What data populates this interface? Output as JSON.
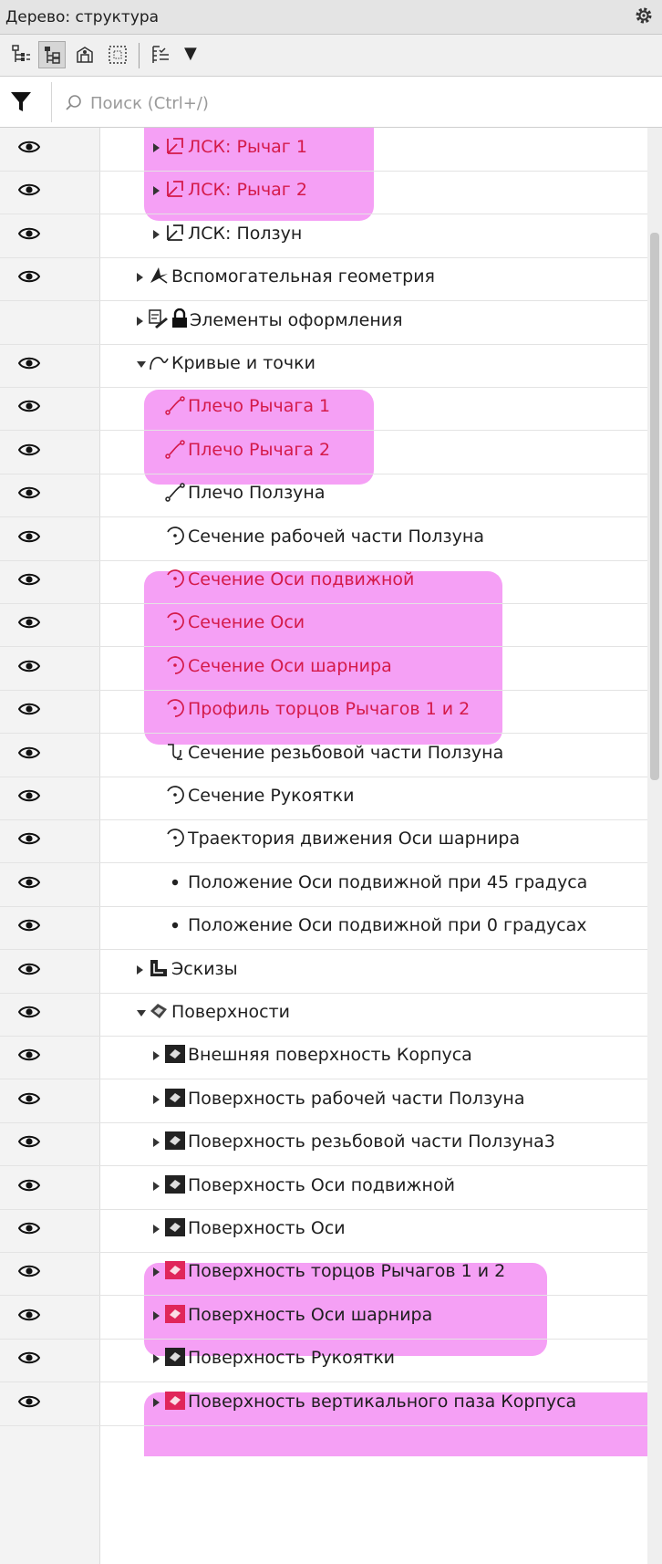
{
  "panel": {
    "title": "Дерево: структура"
  },
  "toolbar": {
    "more": "▼"
  },
  "search": {
    "placeholder": "Поиск (Ctrl+/)",
    "value": ""
  },
  "colors": {
    "highlight": "#f5a0f5",
    "red_text": "#d41a4a",
    "eye_column": "#f3f3f3"
  },
  "tree": [
    {
      "label": "ЛСК: Рычаг 1",
      "level": 2,
      "expander": "collapsed",
      "icon": "lcs-icon",
      "visible": true,
      "red": true
    },
    {
      "label": "ЛСК: Рычаг 2",
      "level": 2,
      "expander": "collapsed",
      "icon": "lcs-icon",
      "visible": true,
      "red": true
    },
    {
      "label": "ЛСК: Ползун",
      "level": 2,
      "expander": "collapsed",
      "icon": "lcs-icon",
      "visible": true,
      "red": false
    },
    {
      "label": "Вспомогательная геометрия",
      "level": 1,
      "expander": "collapsed",
      "icon": "aux-geometry-icon",
      "visible": true,
      "red": false
    },
    {
      "label": "Элементы оформления",
      "level": 1,
      "expander": "collapsed",
      "icon": "design-elements-icon",
      "visible": false,
      "red": false,
      "lock": true
    },
    {
      "label": "Кривые и точки",
      "level": 1,
      "expander": "expanded",
      "icon": "curves-icon",
      "visible": true,
      "red": false
    },
    {
      "label": "Плечо Рычага 1",
      "level": 2,
      "expander": "none",
      "icon": "segment-icon",
      "visible": true,
      "red": true
    },
    {
      "label": "Плечо Рычага 2",
      "level": 2,
      "expander": "none",
      "icon": "segment-icon",
      "visible": true,
      "red": true
    },
    {
      "label": "Плечо Ползуна",
      "level": 2,
      "expander": "none",
      "icon": "segment-icon",
      "visible": true,
      "red": false
    },
    {
      "label": "Сечение рабочей части Ползуна",
      "level": 2,
      "expander": "none",
      "icon": "circle-icon",
      "visible": true,
      "red": false
    },
    {
      "label": "Сечение Оси подвижной",
      "level": 2,
      "expander": "none",
      "icon": "circle-icon",
      "visible": true,
      "red": true
    },
    {
      "label": "Сечение Оси",
      "level": 2,
      "expander": "none",
      "icon": "circle-icon",
      "visible": true,
      "red": true
    },
    {
      "label": "Сечение Оси шарнира",
      "level": 2,
      "expander": "none",
      "icon": "circle-icon",
      "visible": true,
      "red": true
    },
    {
      "label": "Профиль торцов Рычагов 1 и 2",
      "level": 2,
      "expander": "none",
      "icon": "circle-icon",
      "visible": true,
      "red": true
    },
    {
      "label": "Сечение резьбовой части Ползуна",
      "level": 2,
      "expander": "none",
      "icon": "spiral-icon",
      "visible": true,
      "red": false
    },
    {
      "label": "Сечение Рукоятки",
      "level": 2,
      "expander": "none",
      "icon": "circle-icon",
      "visible": true,
      "red": false
    },
    {
      "label": "Траектория движения Оси шарнира",
      "level": 2,
      "expander": "none",
      "icon": "circle-icon",
      "visible": true,
      "red": false
    },
    {
      "label": "Положение Оси подвижной при 45 градуса",
      "level": 2,
      "expander": "none",
      "icon": "point-icon",
      "visible": true,
      "red": false
    },
    {
      "label": "Положение Оси подвижной при 0 градусах",
      "level": 2,
      "expander": "none",
      "icon": "point-icon",
      "visible": true,
      "red": false
    },
    {
      "label": "Эскизы",
      "level": 1,
      "expander": "collapsed",
      "icon": "sketch-icon",
      "visible": true,
      "red": false
    },
    {
      "label": "Поверхности",
      "level": 1,
      "expander": "expanded",
      "icon": "surfaces-icon",
      "visible": true,
      "red": false
    },
    {
      "label": "Внешняя поверхность Корпуса",
      "level": 2,
      "expander": "collapsed",
      "icon": "surface-icon",
      "visible": true,
      "red": false
    },
    {
      "label": "Поверхность рабочей части Ползуна",
      "level": 2,
      "expander": "collapsed",
      "icon": "surface-icon",
      "visible": true,
      "red": false
    },
    {
      "label": "Поверхность резьбовой части Ползуна3",
      "level": 2,
      "expander": "collapsed",
      "icon": "surface-icon",
      "visible": true,
      "red": false
    },
    {
      "label": "Поверхность Оси подвижной",
      "level": 2,
      "expander": "collapsed",
      "icon": "surface-icon",
      "visible": true,
      "red": false
    },
    {
      "label": "Поверхность Оси",
      "level": 2,
      "expander": "collapsed",
      "icon": "surface-icon",
      "visible": true,
      "red": false
    },
    {
      "label": "Поверхность торцов Рычагов 1 и 2",
      "level": 2,
      "expander": "collapsed",
      "icon": "surface-icon",
      "visible": true,
      "red": false,
      "icon_red": true
    },
    {
      "label": "Поверхность Оси шарнира",
      "level": 2,
      "expander": "collapsed",
      "icon": "surface-icon",
      "visible": true,
      "red": false,
      "icon_red": true
    },
    {
      "label": "Поверхность Рукоятки",
      "level": 2,
      "expander": "collapsed",
      "icon": "surface-icon",
      "visible": true,
      "red": false
    },
    {
      "label": "Поверхность вертикального паза Корпуса",
      "level": 2,
      "expander": "collapsed",
      "icon": "surface-icon",
      "visible": true,
      "red": false,
      "icon_red": true
    }
  ]
}
